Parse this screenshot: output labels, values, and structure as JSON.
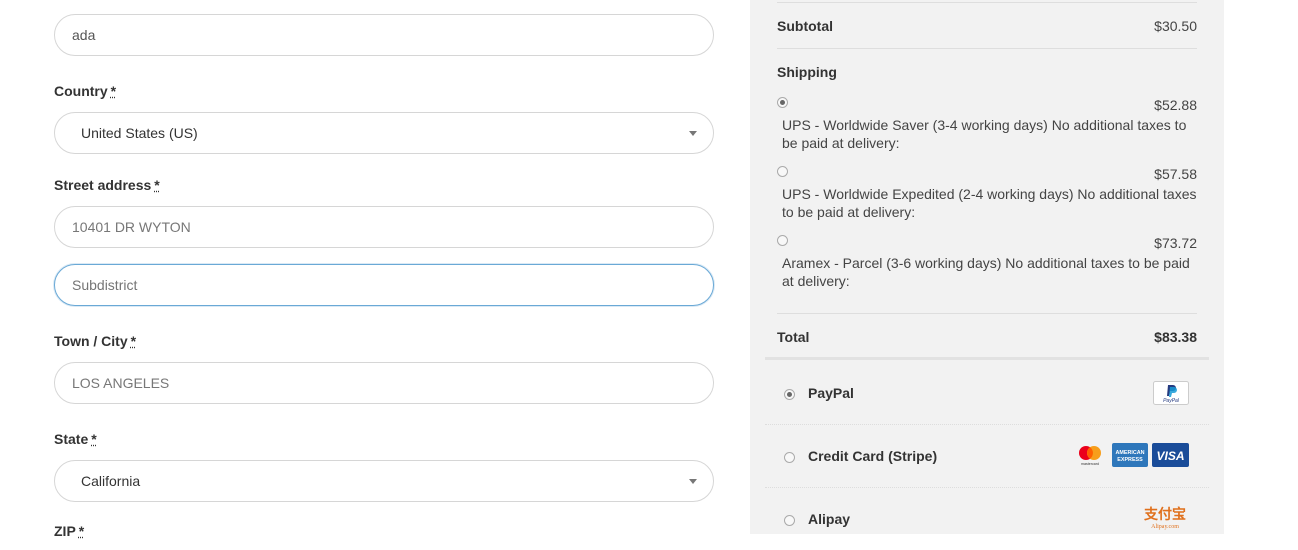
{
  "form": {
    "company_value": "ada",
    "country_label": "Country",
    "country_value": "United States (US)",
    "street_label": "Street address",
    "street_value": "10401 DR WYTON",
    "subdistrict_placeholder": "Subdistrict",
    "city_label": "Town / City",
    "city_value": "LOS ANGELES",
    "state_label": "State",
    "state_value": "California",
    "zip_label": "ZIP",
    "required_mark": "*"
  },
  "summary": {
    "subtotal_label": "Subtotal",
    "subtotal_value": "$30.50",
    "shipping_label": "Shipping",
    "shipping_options": [
      {
        "price": "$52.88",
        "desc": "UPS - Worldwide Saver (3-4 working days) No additional taxes to be paid at delivery:",
        "selected": true
      },
      {
        "price": "$57.58",
        "desc": "UPS - Worldwide Expedited (2-4 working days) No additional taxes to be paid at delivery:",
        "selected": false
      },
      {
        "price": "$73.72",
        "desc": "Aramex - Parcel (3-6 working days) No additional taxes to be paid at delivery:",
        "selected": false
      }
    ],
    "total_label": "Total",
    "total_value": "$83.38"
  },
  "payment": {
    "methods": [
      {
        "label": "PayPal",
        "selected": true
      },
      {
        "label": "Credit Card (Stripe)",
        "selected": false
      },
      {
        "label": "Alipay",
        "selected": false
      }
    ],
    "logo_paypal_text": "PayPal",
    "logo_amex_text": "AMERICAN EXPRESS",
    "logo_visa_text": "VISA",
    "logo_mastercard_text": "mastercard",
    "logo_alipay_cn": "支付宝",
    "logo_alipay_en": "Alipay.com"
  },
  "colors": {
    "focus_border": "#6aa9d6",
    "summary_bg": "#f2f2f2",
    "visa_blue": "#1a4c99",
    "amex_blue": "#2e77bb",
    "alipay_orange": "#e0701c"
  }
}
